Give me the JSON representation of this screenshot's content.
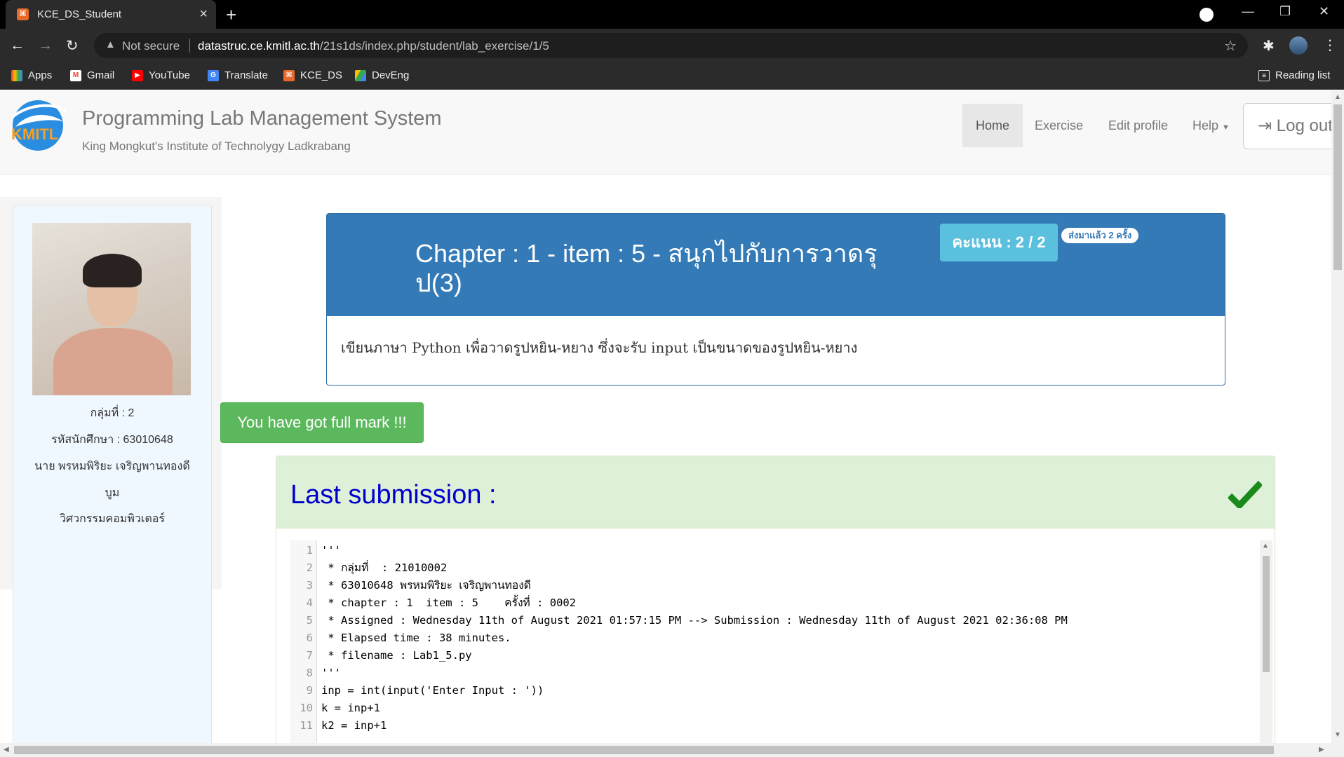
{
  "browser": {
    "tab_title": "KCE_DS_Student",
    "security_label": "Not secure",
    "url_host": "datastruc.ce.kmitl.ac.th",
    "url_path": "/21s1ds/index.php/student/lab_exercise/1/5",
    "bookmarks": [
      "Apps",
      "Gmail",
      "YouTube",
      "Translate",
      "KCE_DS",
      "DevEng"
    ],
    "reading_list": "Reading list"
  },
  "header": {
    "title": "Programming Lab Management System",
    "subtitle": "King Mongkut's Institute of Technolygy Ladkrabang",
    "logo_text": "KMITL",
    "nav": {
      "home": "Home",
      "exercise": "Exercise",
      "edit_profile": "Edit profile",
      "help": "Help",
      "logout": "Log out"
    }
  },
  "student": {
    "group": "กลุ่มที่ : 2",
    "student_id": "รหัสนักศึกษา : 63010648",
    "name_line1": "นาย พรหมพิริยะ เจริญพานทองดี",
    "name_line2": "บูม",
    "department": "วิศวกรรมคอมพิวเตอร์"
  },
  "exercise": {
    "title": "Chapter : 1 - item : 5 - สนุกไปกับการวาดรุป(3)",
    "score": "คะแนน : 2 / 2",
    "sent_badge": "ส่งมาแล้ว 2 ครั้ง",
    "description": "เขียนภาษา Python เพื่อวาดรูปหยิน-หยาง ซึ่งจะรับ input เป็นขนาดของรูปหยิน-หยาง"
  },
  "alert": "You have got full mark !!!",
  "submission": {
    "heading": "Last submission :",
    "lines": [
      "'''",
      " * กลุ่มที่  : 21010002",
      " * 63010648 พรหมพิริยะ เจริญพานทองดี",
      " * chapter : 1  item : 5    ครั้งที่ : 0002",
      " * Assigned : Wednesday 11th of August 2021 01:57:15 PM --> Submission : Wednesday 11th of August 2021 02:36:08 PM",
      " * Elapsed time : 38 minutes.",
      " * filename : Lab1_5.py",
      "'''",
      "inp = int(input('Enter Input : '))",
      "k = inp+1",
      "k2 = inp+1"
    ],
    "line_numbers": [
      "1",
      "2",
      "3",
      "4",
      "5",
      "6",
      "7",
      "8",
      "9",
      "10",
      "11"
    ]
  },
  "colors": {
    "primary": "#337ab7",
    "info": "#5bc0de",
    "success": "#5cb85c",
    "success_bg": "#dff0d8",
    "heading_blue": "#0000cd",
    "check_green": "#1a8a1a"
  }
}
